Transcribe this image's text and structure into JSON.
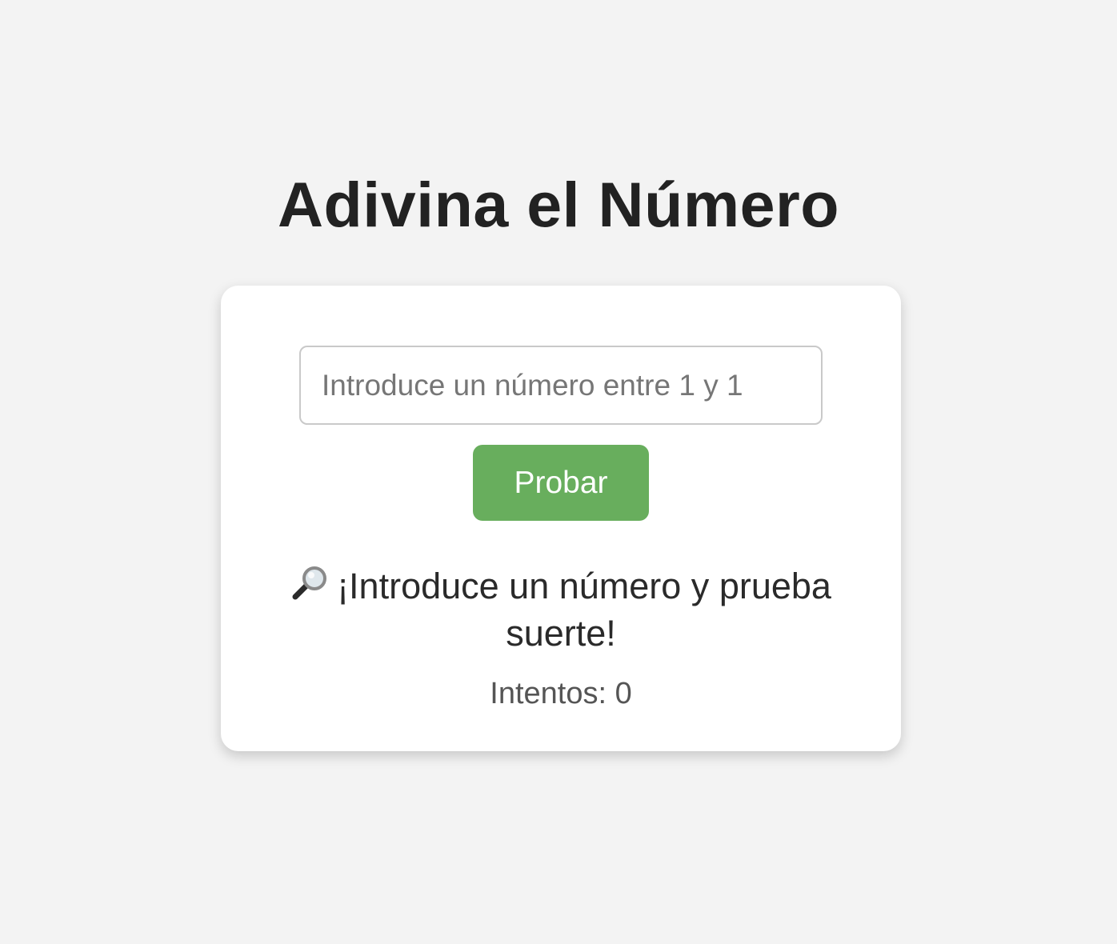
{
  "page": {
    "title": "Adivina el Número"
  },
  "game": {
    "input_placeholder": "Introduce un número entre 1 y 1",
    "input_value": "",
    "button_label": "Probar",
    "message_icon": "magnifier-icon",
    "message": "¡Introduce un número y prueba suerte!",
    "attempts_text": "Intentos: 0"
  },
  "colors": {
    "background": "#f3f3f3",
    "card": "#ffffff",
    "button": "#68ae5d",
    "title_text": "#222222"
  }
}
